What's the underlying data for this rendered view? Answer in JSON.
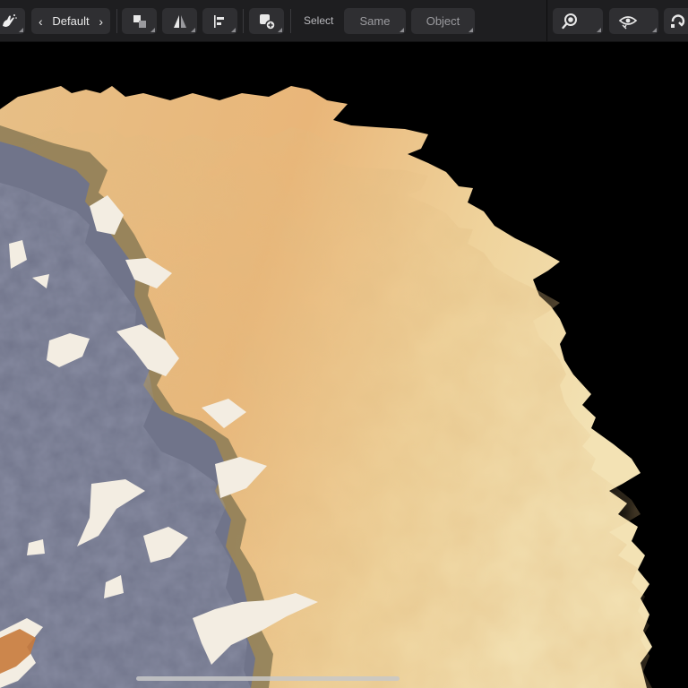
{
  "toolbar": {
    "brush_tool_icon": "brush-hand-icon",
    "prev_icon": "chevron-left-icon",
    "preset_label": "Default",
    "next_icon": "chevron-right-icon",
    "arrange_icon": "arrange-icon",
    "flip_icon": "flip-icon",
    "align_icon": "align-left-icon",
    "add_icon": "add-shape-icon",
    "select_label": "Select",
    "same_label": "Same",
    "object_label": "Object",
    "zoom_icon": "zoom-icon",
    "view_icon": "eye-icon",
    "snap_icon": "snapping-icon"
  },
  "colors": {
    "toolbar_bg": "#1e1e20",
    "button_bg": "#2f2f32",
    "canvas_bg": "#000000",
    "paint_tan": "#e6b97e",
    "paint_light": "#f2dca6",
    "paint_slate": "#6f7386"
  }
}
